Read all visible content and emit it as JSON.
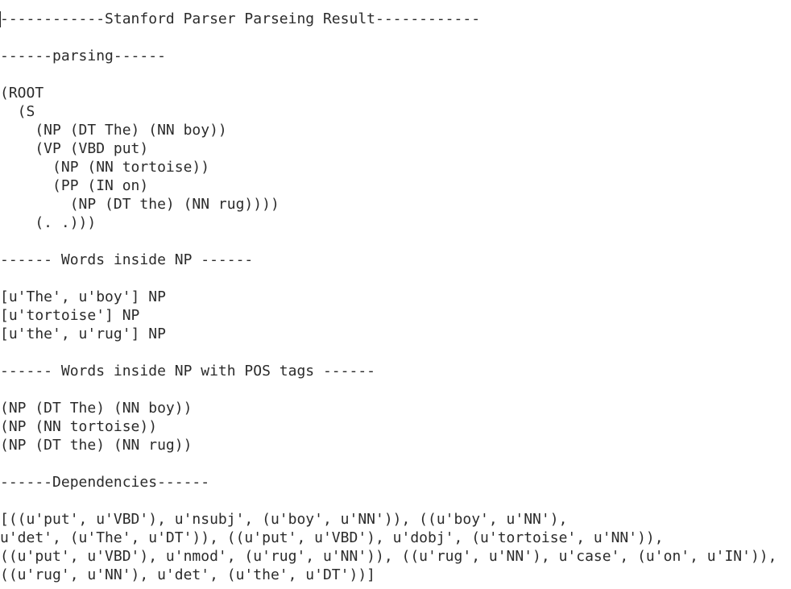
{
  "terminal": {
    "lines": [
      "------------Stanford Parser Parseing Result------------",
      "",
      "------parsing------",
      "",
      "(ROOT",
      "  (S",
      "    (NP (DT The) (NN boy))",
      "    (VP (VBD put)",
      "      (NP (NN tortoise))",
      "      (PP (IN on)",
      "        (NP (DT the) (NN rug))))",
      "    (. .)))",
      "",
      "------ Words inside NP ------",
      "",
      "[u'The', u'boy'] NP",
      "[u'tortoise'] NP",
      "[u'the', u'rug'] NP",
      "",
      "------ Words inside NP with POS tags ------",
      "",
      "(NP (DT The) (NN boy))",
      "(NP (NN tortoise))",
      "(NP (DT the) (NN rug))",
      "",
      "------Dependencies------",
      "",
      "[((u'put', u'VBD'), u'nsubj', (u'boy', u'NN')), ((u'boy', u'NN'),",
      "u'det', (u'The', u'DT')), ((u'put', u'VBD'), u'dobj', (u'tortoise', u'NN')),",
      "((u'put', u'VBD'), u'nmod', (u'rug', u'NN')), ((u'rug', u'NN'), u'case', (u'on', u'IN')),",
      "((u'rug', u'NN'), u'det', (u'the', u'DT'))]"
    ]
  }
}
